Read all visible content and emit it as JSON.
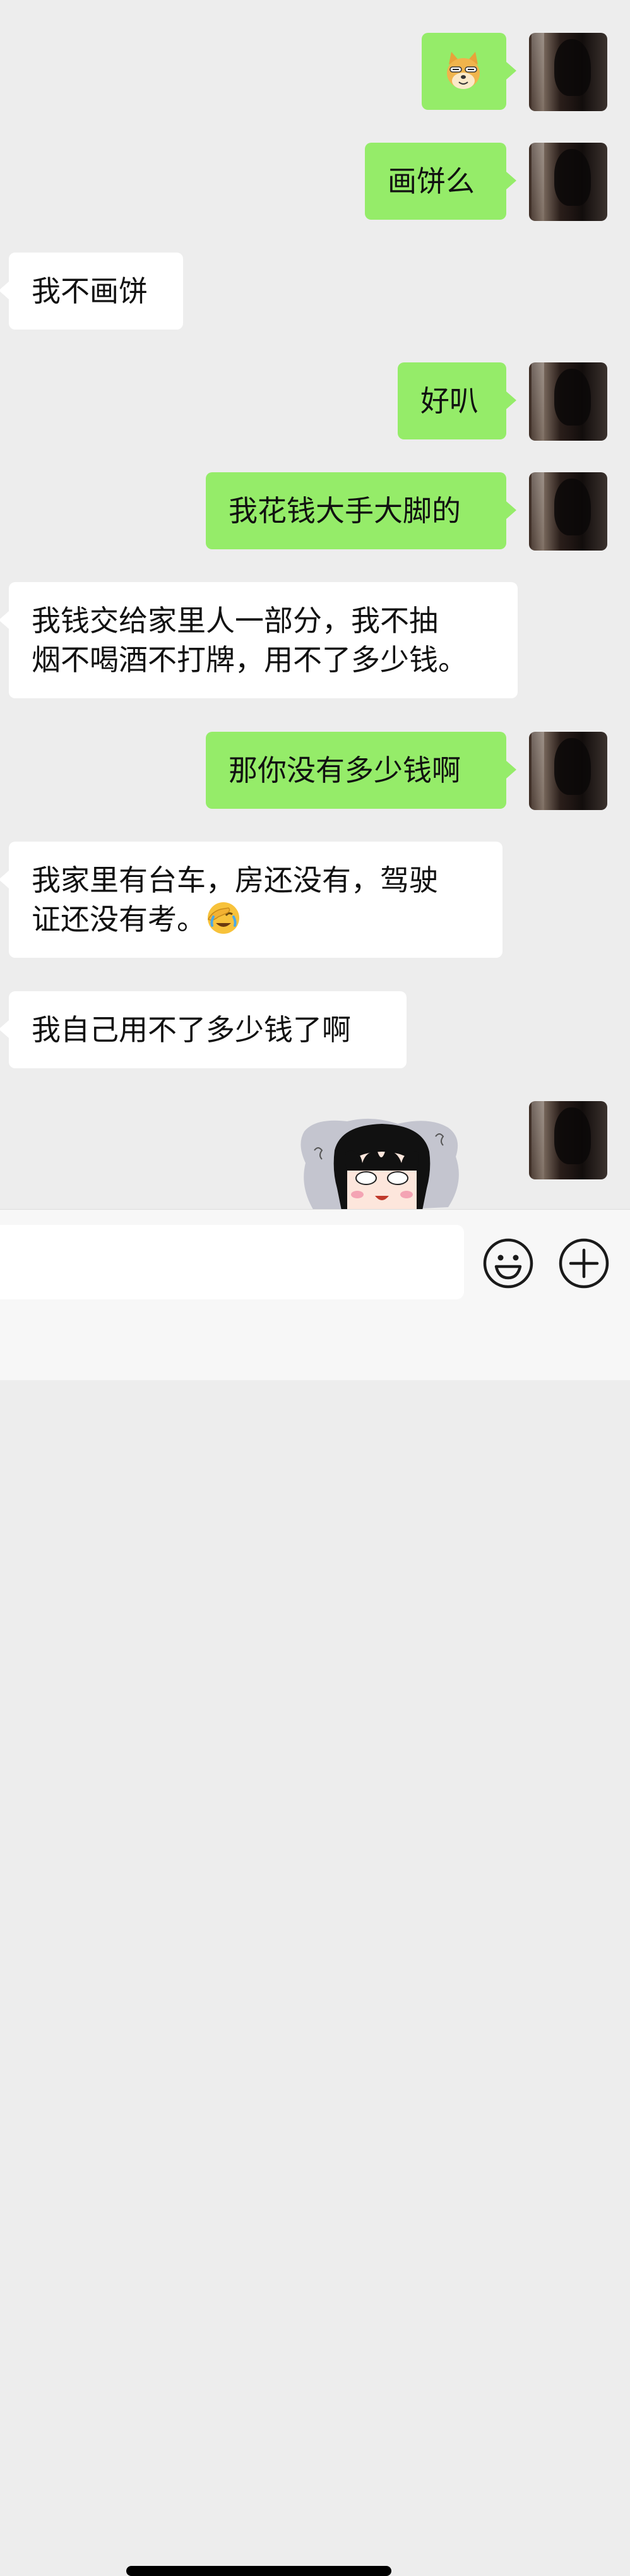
{
  "messages": [
    {
      "side": "right",
      "type": "emoji-sticker",
      "icon": "doge-icon"
    },
    {
      "side": "right",
      "type": "text",
      "text": "画饼么"
    },
    {
      "side": "left",
      "type": "text",
      "text": "我不画饼"
    },
    {
      "side": "right",
      "type": "text",
      "text": "好叭"
    },
    {
      "side": "right",
      "type": "text",
      "text": "我花钱大手大脚的"
    },
    {
      "side": "left",
      "type": "text",
      "lines": [
        "我钱交给家里人一部分，我不抽",
        "烟不喝酒不打牌，用不了多少钱。"
      ]
    },
    {
      "side": "right",
      "type": "text",
      "text": "那你没有多少钱啊"
    },
    {
      "side": "left",
      "type": "text",
      "lines": [
        "我家里有台车，房还没有，驾驶",
        "证还没有考。"
      ],
      "trailing_emoji": "facepalm-emoji"
    },
    {
      "side": "left",
      "type": "text",
      "text": "我自己用不了多少钱了啊"
    },
    {
      "side": "right",
      "type": "sticker",
      "icon": "cartoon-girl-sticker"
    }
  ],
  "input_bar": {
    "text_value": "",
    "emoji_icon": "smiley-icon",
    "plus_icon": "plus-circle-icon"
  },
  "colors": {
    "background": "#ededed",
    "right_bubble": "#95ec69",
    "left_bubble": "#ffffff"
  }
}
